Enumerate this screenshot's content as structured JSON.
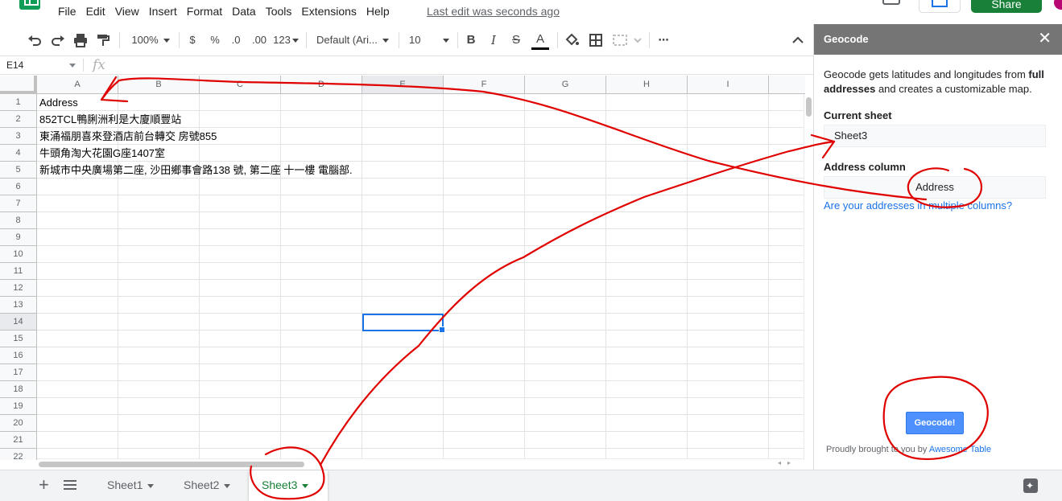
{
  "menu": {
    "items": [
      "File",
      "Edit",
      "View",
      "Insert",
      "Format",
      "Data",
      "Tools",
      "Extensions",
      "Help"
    ],
    "last_edit": "Last edit was seconds ago"
  },
  "header": {
    "share_label": "Share"
  },
  "toolbar": {
    "zoom": "100%",
    "currency": "$",
    "percent": "%",
    "dec_decrease": ".0",
    "dec_increase": ".00",
    "more_formats": "123",
    "font": "Default (Ari...",
    "font_size": "10",
    "bold": "B",
    "italic": "I",
    "strike": "S",
    "text_color": "A",
    "more": "⋯"
  },
  "formula_bar": {
    "name_box": "E14",
    "fx": "fx"
  },
  "grid": {
    "columns": [
      "A",
      "B",
      "C",
      "D",
      "E",
      "F",
      "G",
      "H",
      "I"
    ],
    "rows": [
      "1",
      "2",
      "3",
      "4",
      "5",
      "6",
      "7",
      "8",
      "9",
      "10",
      "11",
      "12",
      "13",
      "14",
      "15",
      "16",
      "17",
      "18",
      "19",
      "20",
      "21",
      "22"
    ],
    "selected_cell": "E14",
    "column_a_values": [
      "Address",
      "852TCL鴨脷洲利是大廈順豐站",
      "東涌福朋喜來登酒店前台轉交 房號855",
      "牛頭角淘大花園G座1407室",
      "新城市中央廣場第二座, 沙田鄉事會路138 號, 第二座 十一樓 電腦部."
    ]
  },
  "sheets": {
    "tabs": [
      {
        "label": "Sheet1",
        "active": false
      },
      {
        "label": "Sheet2",
        "active": false
      },
      {
        "label": "Sheet3",
        "active": true
      }
    ]
  },
  "panel": {
    "title": "Geocode",
    "close": "✕",
    "description_pre": "Geocode gets latitudes and longitudes from ",
    "description_bold_1": "full",
    "description_bold_2": "addresses",
    "description_post": " and creates a customizable map.",
    "current_sheet_label": "Current sheet",
    "current_sheet_value": "Sheet3",
    "address_column_label": "Address column",
    "address_column_value": "Address",
    "multi_column_link": "Are your addresses in multiple columns?",
    "geocode_button": "Geocode!",
    "credit_pre": "Proudly brought to you by ",
    "credit_link": "Awesome Table"
  },
  "colors": {
    "annotation": "#e00000",
    "selection": "#1a73e8",
    "share_green": "#188038",
    "panel_header": "#757575",
    "geocode_button": "#4d90fe"
  }
}
